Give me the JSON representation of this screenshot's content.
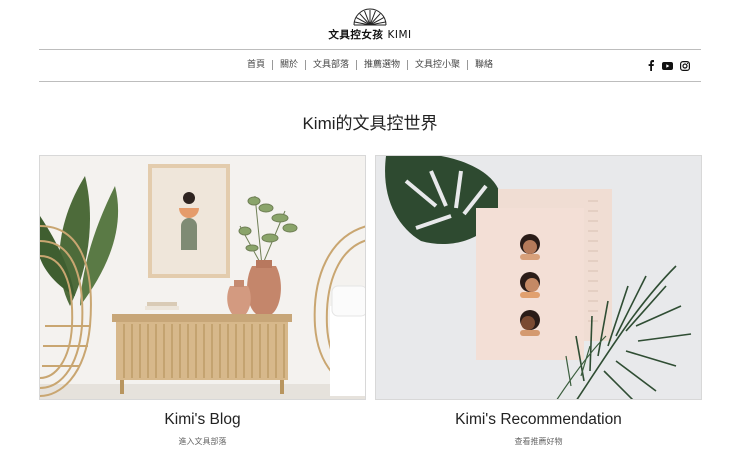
{
  "site": {
    "logo_cjk": "文具控女孩",
    "logo_latin": "KIMI"
  },
  "nav": {
    "items": [
      "首頁",
      "關於",
      "文具部落",
      "推薦選物",
      "文具控小聚",
      "聯絡"
    ]
  },
  "social": [
    "facebook-icon",
    "youtube-icon",
    "instagram-icon"
  ],
  "headline": {
    "latin": "Kimi",
    "cjk": "的文具控世界"
  },
  "cards": [
    {
      "title": "Kimi's Blog",
      "link": "進入文具部落"
    },
    {
      "title": "Kimi's Recommendation",
      "link": "查看推薦好物"
    }
  ],
  "colors": {
    "rule": "#bdbdbd",
    "text": "#222222",
    "muted": "#666666"
  }
}
